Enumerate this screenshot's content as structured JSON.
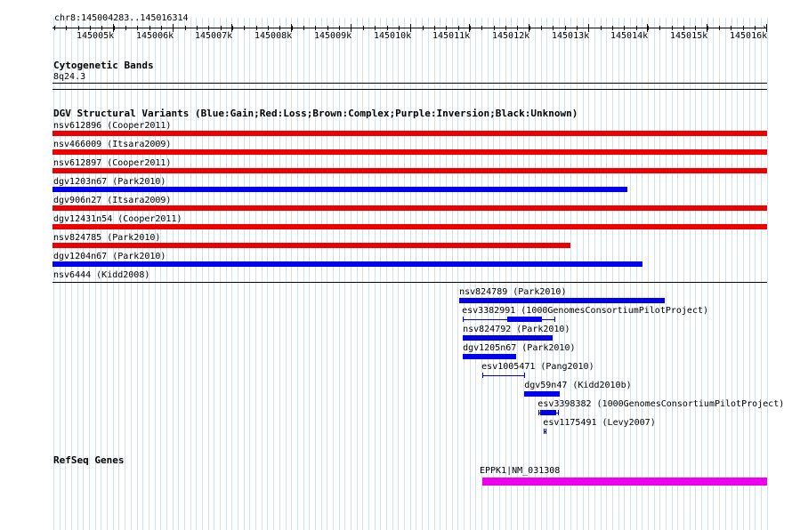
{
  "ruler": {
    "position_label": "chr8:145004283..145016314",
    "start": 145004283,
    "end": 145016314,
    "tick_labels": [
      "145005k",
      "145006k",
      "145007k",
      "145008k",
      "145009k",
      "145010k",
      "145011k",
      "145012k",
      "145013k",
      "145014k",
      "145015k",
      "145016k"
    ]
  },
  "cytobands": {
    "title": "Cytogenetic Bands",
    "band": "8q24.3"
  },
  "dgv": {
    "title": "DGV Structural Variants (Blue:Gain;Red:Loss;Brown:Complex;Purple:Inversion;Black:Unknown)",
    "colors": {
      "gain": "#0000ee",
      "loss": "#ee0000"
    },
    "wide": [
      {
        "label": "nsv612896 (Cooper2011)",
        "type": "loss",
        "bar_start": 145004283,
        "bar_end": 145016314
      },
      {
        "label": "nsv466009 (Itsara2009)",
        "type": "loss",
        "bar_start": 145004283,
        "bar_end": 145016314
      },
      {
        "label": "nsv612897 (Cooper2011)",
        "type": "loss",
        "bar_start": 145004283,
        "bar_end": 145016314
      },
      {
        "label": "dgv1203n67 (Park2010)",
        "type": "gain",
        "bar_start": 145004283,
        "bar_end": 145013966
      },
      {
        "label": "dgv906n27 (Itsara2009)",
        "type": "loss",
        "bar_start": 145004283,
        "bar_end": 145016314
      },
      {
        "label": "dgv12431n54 (Cooper2011)",
        "type": "loss",
        "bar_start": 145004283,
        "bar_end": 145016314
      },
      {
        "label": "nsv824785 (Park2010)",
        "type": "loss",
        "bar_start": 145004283,
        "bar_end": 145013004
      },
      {
        "label": "dgv1204n67 (Park2010)",
        "type": "gain",
        "bar_start": 145004283,
        "bar_end": 145014221
      },
      {
        "label": "nsv6444 (Kidd2008)",
        "type": "loss",
        "bar_start": null,
        "bar_end": null
      }
    ],
    "small": [
      {
        "label": "nsv824789 (Park2010)",
        "type": "gain",
        "style": "solid",
        "start": 145011131,
        "end": 145014592
      },
      {
        "label": "esv3382991 (1000GenomesConsortiumPilotProject)",
        "type": "gain",
        "style": "interval",
        "start": 145011191,
        "end": 145012726,
        "block_start": 145011942,
        "block_end": 145012529
      },
      {
        "label": "nsv824792 (Park2010)",
        "type": "gain",
        "style": "solid",
        "start": 145011191,
        "end": 145012709
      },
      {
        "label": "dgv1205n67 (Park2010)",
        "type": "gain",
        "style": "solid",
        "start": 145011191,
        "end": 145012092
      },
      {
        "label": "esv1005471 (Pang2010)",
        "type": "gain",
        "style": "interval",
        "start": 145011522,
        "end": 145012227
      },
      {
        "label": "dgv59n47 (Kidd2010b)",
        "type": "gain",
        "style": "solid",
        "start": 145012227,
        "end": 145012829
      },
      {
        "label": "esv3398382 (1000GenomesConsortiumPilotProject)",
        "type": "gain",
        "style": "interval",
        "start": 145012468,
        "end": 145012799,
        "block_start": 145012498,
        "block_end": 145012769
      },
      {
        "label": "esv1175491 (Levy2007)",
        "type": "gain",
        "style": "point",
        "start": 145012558,
        "end": 145012588
      }
    ]
  },
  "refseq": {
    "title": "RefSeq Genes",
    "gene": {
      "label": "EPPK1|NM_031308",
      "color": "#ee00ee",
      "start": 145011522,
      "end": 145016314
    }
  }
}
